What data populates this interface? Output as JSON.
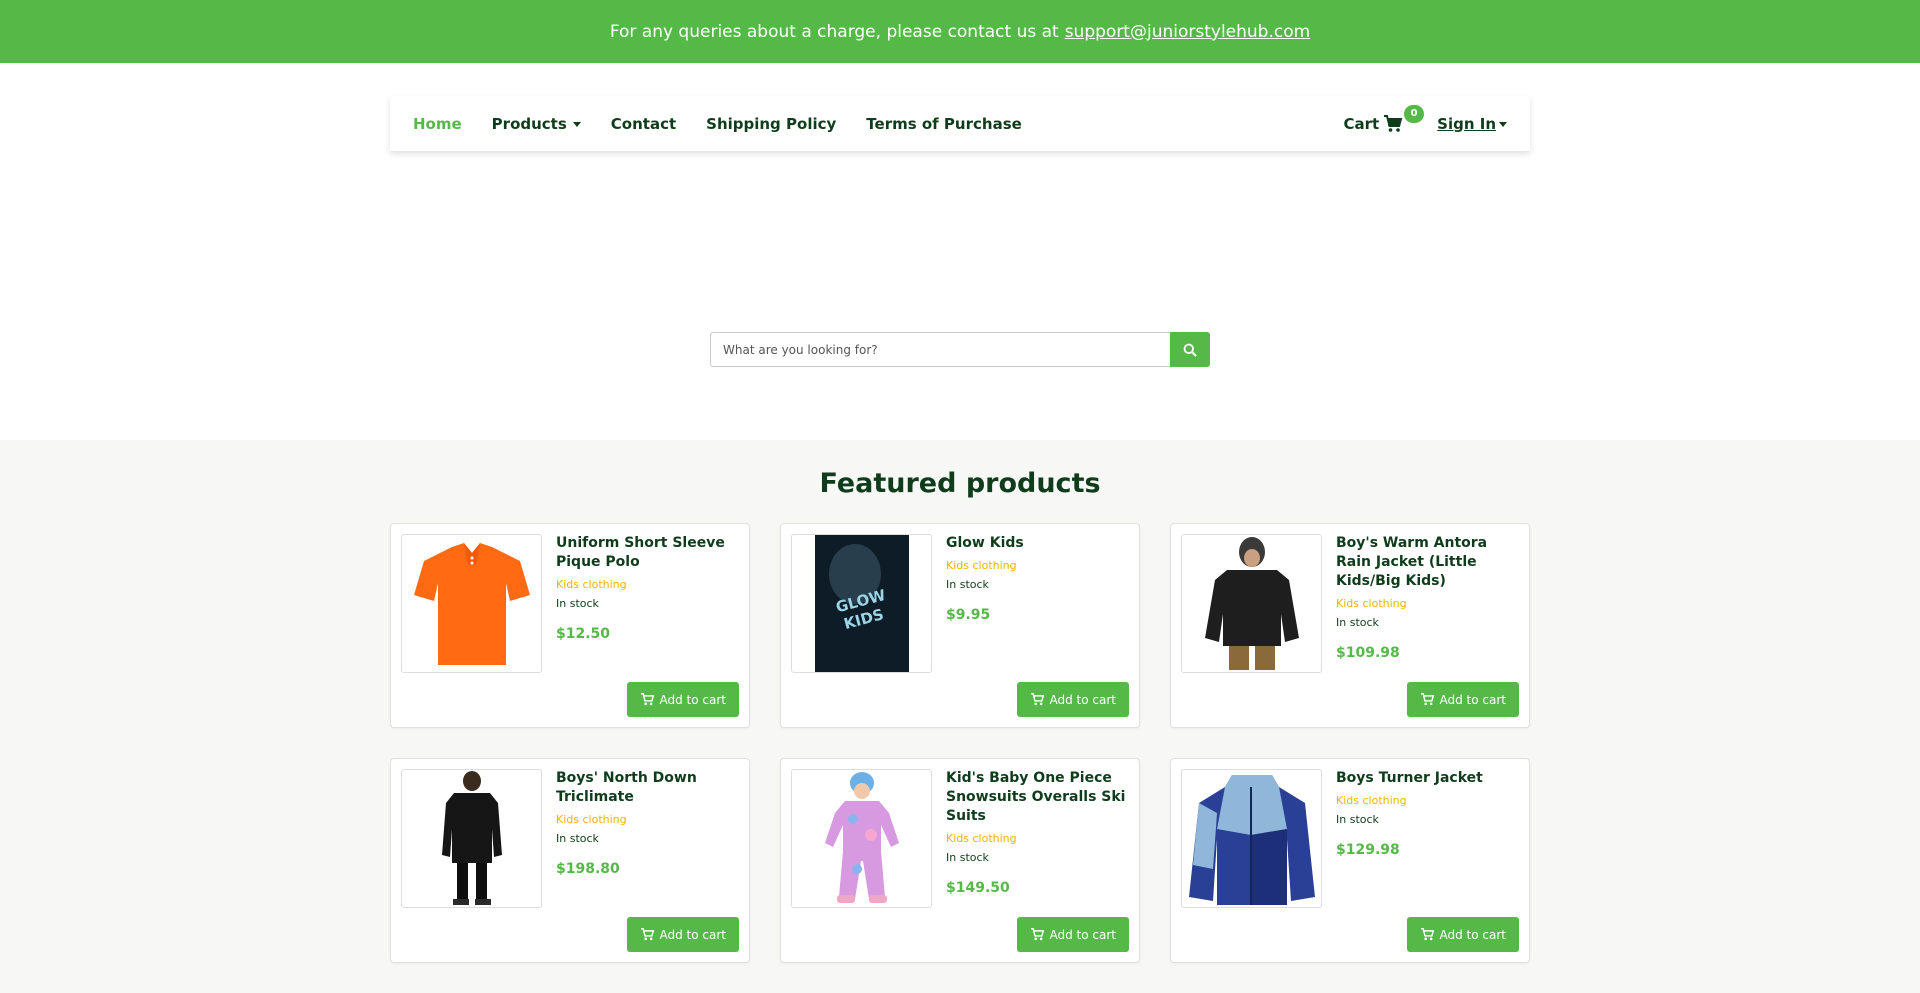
{
  "announcement": {
    "text": "For any queries about a charge, please contact us at",
    "email": "support@juniorstylehub.com"
  },
  "nav": {
    "items": [
      {
        "label": "Home",
        "active": true
      },
      {
        "label": "Products",
        "dropdown": true
      },
      {
        "label": "Contact"
      },
      {
        "label": "Shipping Policy"
      },
      {
        "label": "Terms of Purchase"
      }
    ],
    "cart_label": "Cart",
    "cart_count": "0",
    "signin_label": "Sign In"
  },
  "search": {
    "placeholder": "What are you looking for?"
  },
  "featured": {
    "title": "Featured products",
    "add_label": "Add to cart",
    "products": [
      {
        "name": "Uniform Short Sleeve Pique Polo",
        "category": "Kids clothing",
        "stock": "In stock",
        "price": "$12.50",
        "image": "orange-polo-shirt"
      },
      {
        "name": "Glow Kids",
        "category": "Kids clothing",
        "stock": "In stock",
        "price": "$9.95",
        "image": "glow-kids-book-cover"
      },
      {
        "name": "Boy's Warm Antora Rain Jacket (Little Kids/Big Kids)",
        "category": "Kids clothing",
        "stock": "In stock",
        "price": "$109.98",
        "image": "black-rain-jacket"
      },
      {
        "name": "Boys' North Down Triclimate",
        "category": "Kids clothing",
        "stock": "In stock",
        "price": "$198.80",
        "image": "black-long-coat"
      },
      {
        "name": "Kid's Baby One Piece Snowsuits Overalls Ski Suits",
        "category": "Kids clothing",
        "stock": "In stock",
        "price": "$149.50",
        "image": "pink-snowsuit"
      },
      {
        "name": "Boys Turner Jacket",
        "category": "Kids clothing",
        "stock": "In stock",
        "price": "$129.98",
        "image": "blue-ski-jacket"
      }
    ]
  },
  "colors": {
    "brand_green": "#55b947",
    "dark_text": "#0f3d1c",
    "category_yellow": "#f0b400"
  }
}
